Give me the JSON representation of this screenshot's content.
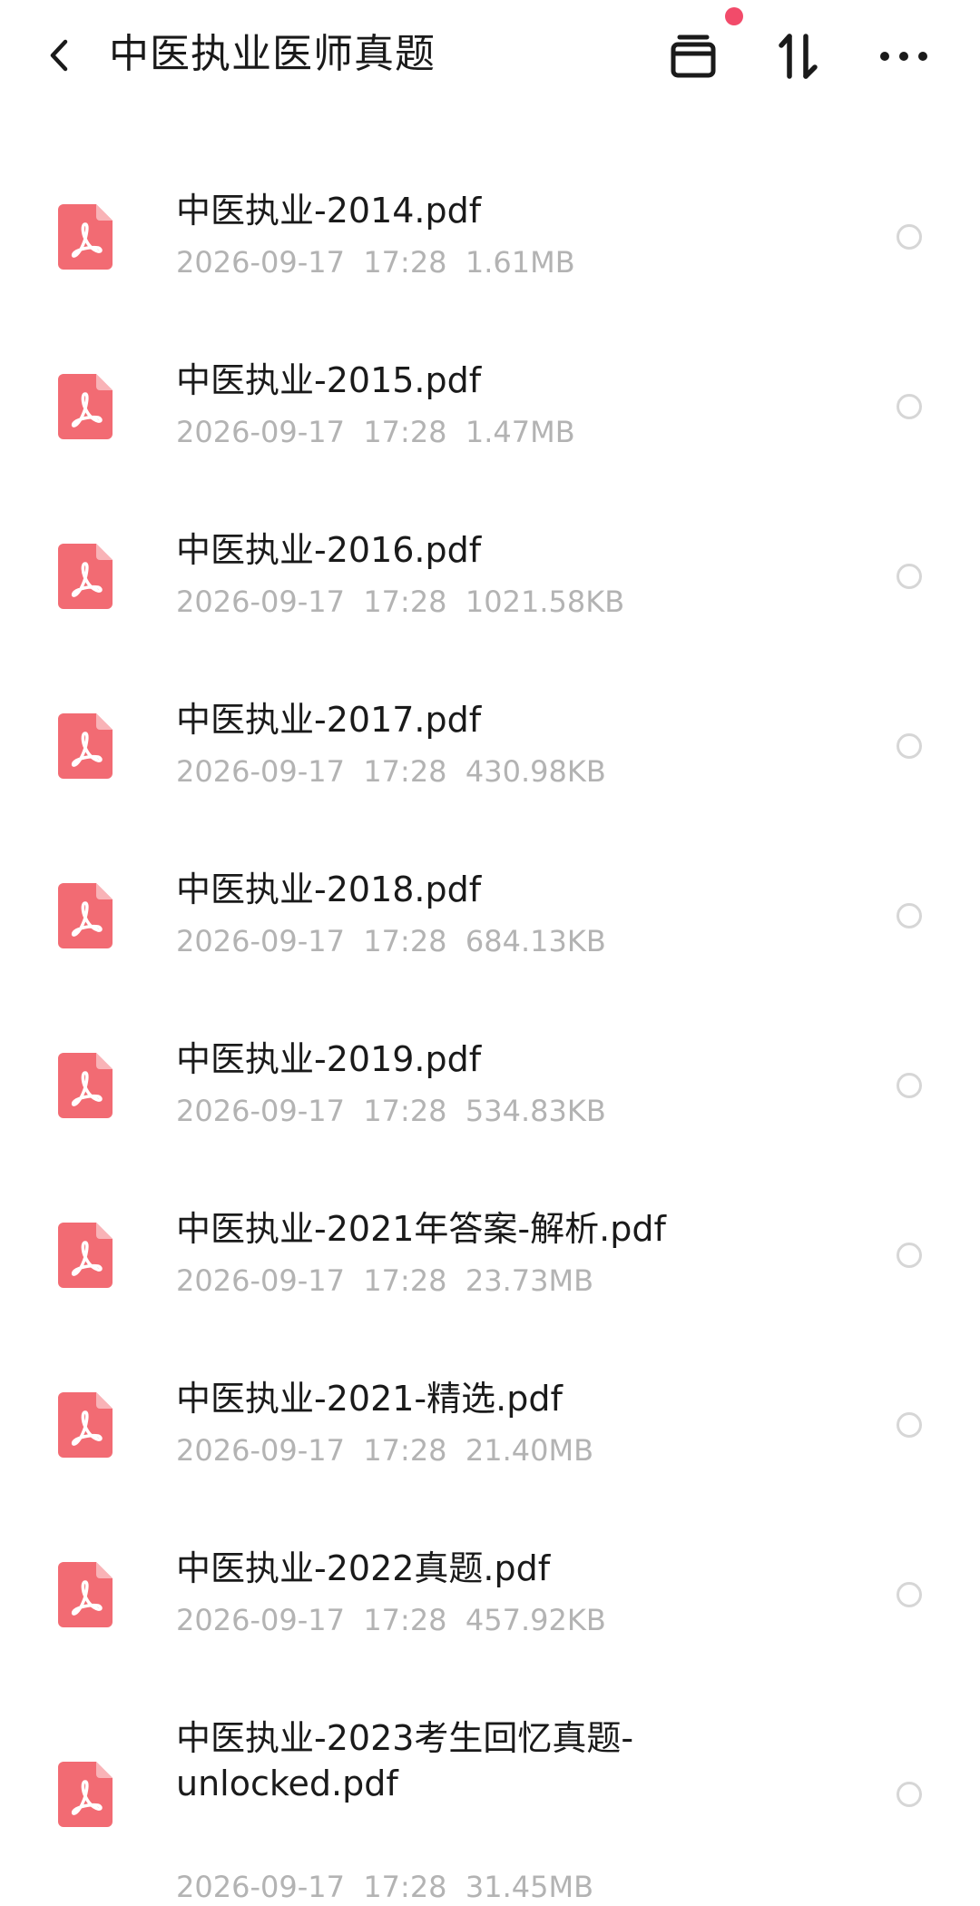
{
  "header": {
    "title": "中医执业医师真题",
    "back_icon": "chevron-left-icon",
    "actions": [
      {
        "icon": "archive-box-icon",
        "has_notification": true
      },
      {
        "icon": "sort-arrows-icon"
      },
      {
        "icon": "more-horizontal-icon"
      }
    ],
    "notification_color": "#f24b6a"
  },
  "colors": {
    "pdf_icon": "#f26b73",
    "meta_text": "#b3b3b3",
    "radio_border": "#d6d6d6"
  },
  "files": [
    {
      "name": "中医执业-2014.pdf",
      "date": "2026-09-17",
      "time": "17:28",
      "size": "1.61MB",
      "icon": "pdf-file-icon"
    },
    {
      "name": "中医执业-2015.pdf",
      "date": "2026-09-17",
      "time": "17:28",
      "size": "1.47MB",
      "icon": "pdf-file-icon"
    },
    {
      "name": "中医执业-2016.pdf",
      "date": "2026-09-17",
      "time": "17:28",
      "size": "1021.58KB",
      "icon": "pdf-file-icon"
    },
    {
      "name": "中医执业-2017.pdf",
      "date": "2026-09-17",
      "time": "17:28",
      "size": "430.98KB",
      "icon": "pdf-file-icon"
    },
    {
      "name": "中医执业-2018.pdf",
      "date": "2026-09-17",
      "time": "17:28",
      "size": "684.13KB",
      "icon": "pdf-file-icon"
    },
    {
      "name": "中医执业-2019.pdf",
      "date": "2026-09-17",
      "time": "17:28",
      "size": "534.83KB",
      "icon": "pdf-file-icon"
    },
    {
      "name": "中医执业-2021年答案-解析.pdf",
      "date": "2026-09-17",
      "time": "17:28",
      "size": "23.73MB",
      "icon": "pdf-file-icon"
    },
    {
      "name": "中医执业-2021-精选.pdf",
      "date": "2026-09-17",
      "time": "17:28",
      "size": "21.40MB",
      "icon": "pdf-file-icon"
    },
    {
      "name": "中医执业-2022真题.pdf",
      "date": "2026-09-17",
      "time": "17:28",
      "size": "457.92KB",
      "icon": "pdf-file-icon"
    },
    {
      "name": "中医执业-2023考生回忆真题-unlocked.pdf",
      "date": "2026-09-17",
      "time": "17:28",
      "size": "31.45MB",
      "icon": "pdf-file-icon"
    }
  ]
}
